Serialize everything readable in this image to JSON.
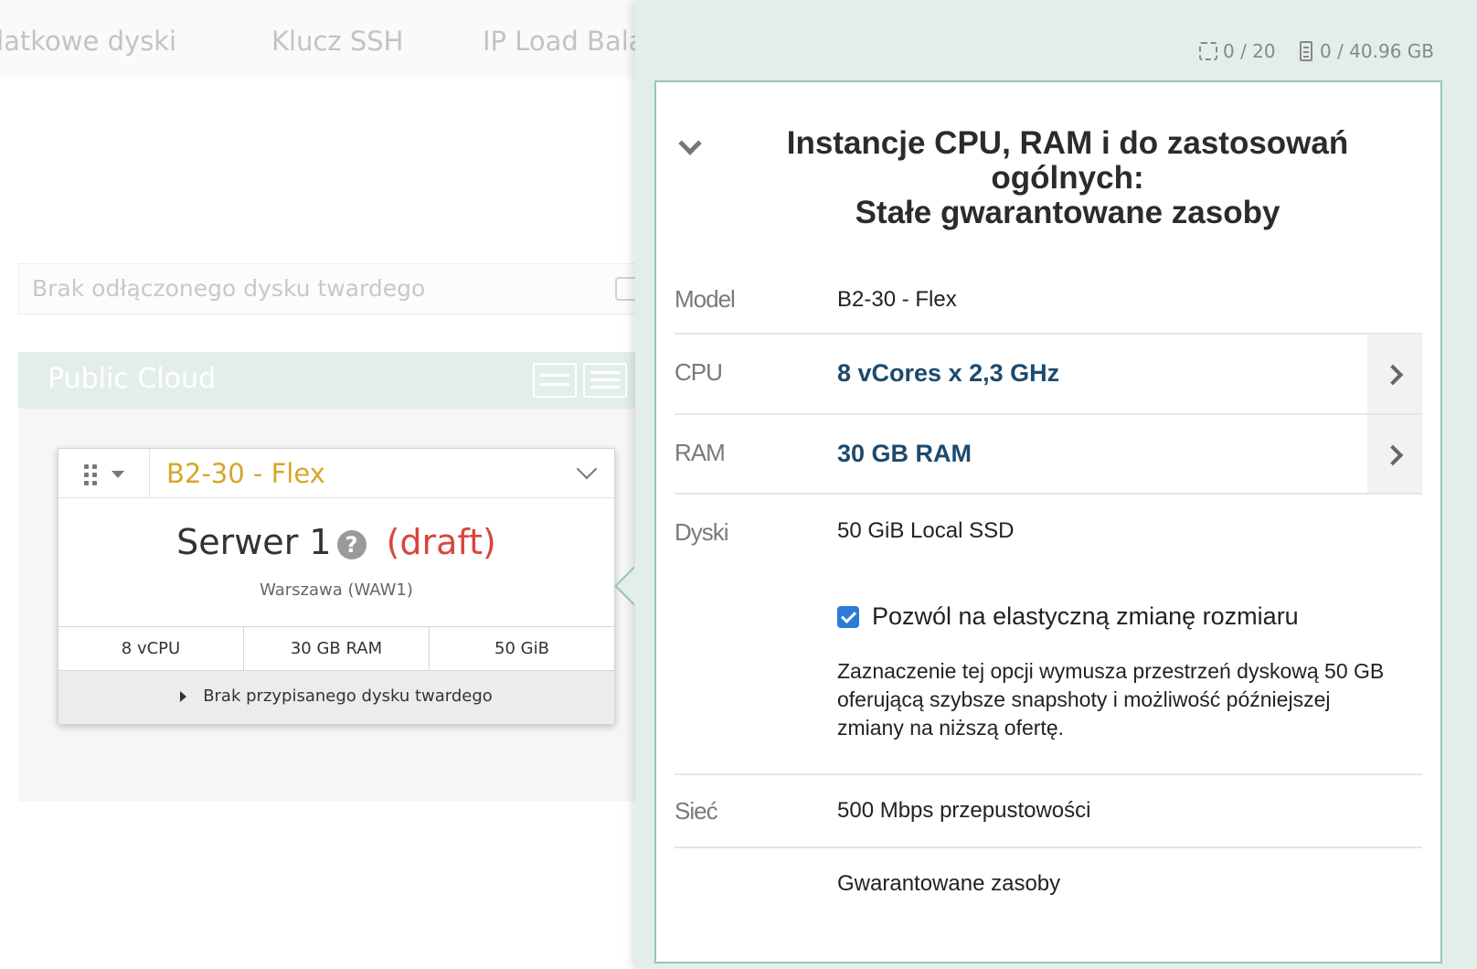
{
  "tabs": [
    "odatkowe dyski",
    "Klucz SSH",
    "IP Load Bala"
  ],
  "search": {
    "placeholder": "Brak odłączonego dysku twardego"
  },
  "public_cloud": {
    "title": "Public Cloud"
  },
  "server_card": {
    "model": "B2-30 - Flex",
    "name": "Serwer 1",
    "help": "?",
    "status": "(draft)",
    "location": "Warszawa (WAW1)",
    "specs": [
      "8 vCPU",
      "30 GB RAM",
      "50 GiB"
    ],
    "disk_note": "Brak przypisanego dysku twardego"
  },
  "quota": {
    "cpu": "0 / 20",
    "storage": "0 / 40.96 GB"
  },
  "detail": {
    "title_lines": [
      "Instancje CPU, RAM i do zastosowań",
      "ogólnych:",
      "Stałe gwarantowane zasoby"
    ],
    "model_label": "Model",
    "model_value": "B2-30 - Flex",
    "cpu_label": "CPU",
    "cpu_value": "8 vCores x 2,3 GHz",
    "ram_label": "RAM",
    "ram_value": "30 GB RAM",
    "disks_label": "Dyski",
    "disks_value": "50 GiB Local SSD",
    "flex_checkbox_label": "Pozwól na elastyczną zmianę rozmiaru",
    "flex_checked": true,
    "flex_description": "Zaznaczenie tej opcji wymusza przestrzeń dyskową 50 GB oferującą szybsze snapshoty i możliwość późniejszej zmiany na niższą ofertę.",
    "network_label": "Sieć",
    "network_value": "500 Mbps przepustowości",
    "guarantee_value": "Gwarantowane zasoby"
  },
  "colors": {
    "accent_gold": "#d4a72c",
    "draft_red": "#d9453d",
    "panel_bg": "#e3eeec",
    "panel_border": "#9ac4ba",
    "value_blue": "#1d4a6e",
    "checkbox_blue": "#2e7ad6"
  },
  "icons": [
    "search-zoom-icon",
    "drag-handle-icon",
    "caret-down-icon",
    "chevron-down-icon",
    "help-icon",
    "caret-right-icon",
    "cpu-chip-icon",
    "memory-icon",
    "chevron-right-icon",
    "checkbox-checked-icon"
  ]
}
